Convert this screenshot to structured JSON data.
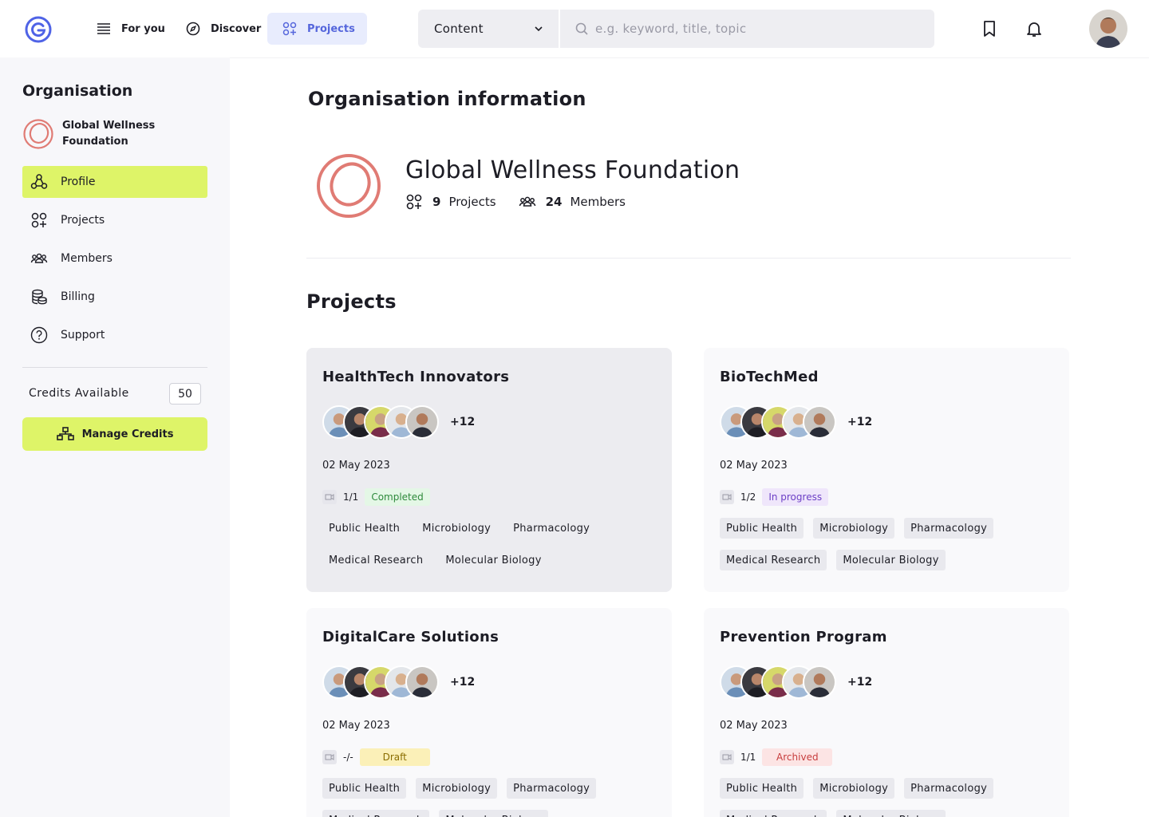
{
  "nav": {
    "for_you": "For you",
    "discover": "Discover",
    "projects": "Projects"
  },
  "search": {
    "category": "Content",
    "placeholder": "e.g. keyword, title, topic"
  },
  "sidebar": {
    "title": "Organisation",
    "org_name": "Global Wellness Foundation",
    "items": [
      {
        "label": "Profile",
        "icon": "shapes-icon",
        "active": true
      },
      {
        "label": "Projects",
        "icon": "grid-plus-icon"
      },
      {
        "label": "Members",
        "icon": "users-icon"
      },
      {
        "label": "Billing",
        "icon": "coins-icon"
      },
      {
        "label": "Support",
        "icon": "help-icon"
      }
    ],
    "credits_label": "Credits Available",
    "credits_value": "50",
    "manage_credits": "Manage Credits"
  },
  "main": {
    "title": "Organisation information",
    "org_name": "Global Wellness Foundation",
    "projects_count": "9",
    "projects_label": "Projects",
    "members_count": "24",
    "members_label": "Members",
    "projects_title": "Projects"
  },
  "colors": {
    "accent": "#def468",
    "brand": "#5566dc",
    "org_logo": "#e07b74"
  },
  "cards": [
    {
      "title": "HealthTech Innovators",
      "more": "+12",
      "date": "02 May 2023",
      "count": "1/1",
      "status": "Completed",
      "tags": [
        "Public Health",
        "Microbiology",
        "Pharmacology",
        "Medical Research",
        "Molecular Biology"
      ]
    },
    {
      "title": "BioTechMed",
      "more": "+12",
      "date": "02 May 2023",
      "count": "1/2",
      "status": "In progress",
      "tags": [
        "Public Health",
        "Microbiology",
        "Pharmacology",
        "Medical Research",
        "Molecular Biology"
      ]
    },
    {
      "title": "DigitalCare Solutions",
      "more": "+12",
      "date": "02 May 2023",
      "count": "-/-",
      "status": "Draft",
      "tags": [
        "Public Health",
        "Microbiology",
        "Pharmacology",
        "Medical Research",
        "Molecular Biology"
      ]
    },
    {
      "title": "Prevention Program",
      "more": "+12",
      "date": "02 May 2023",
      "count": "1/1",
      "status": "Archived",
      "tags": [
        "Public Health",
        "Microbiology",
        "Pharmacology",
        "Medical Research",
        "Molecular Biology"
      ]
    }
  ]
}
